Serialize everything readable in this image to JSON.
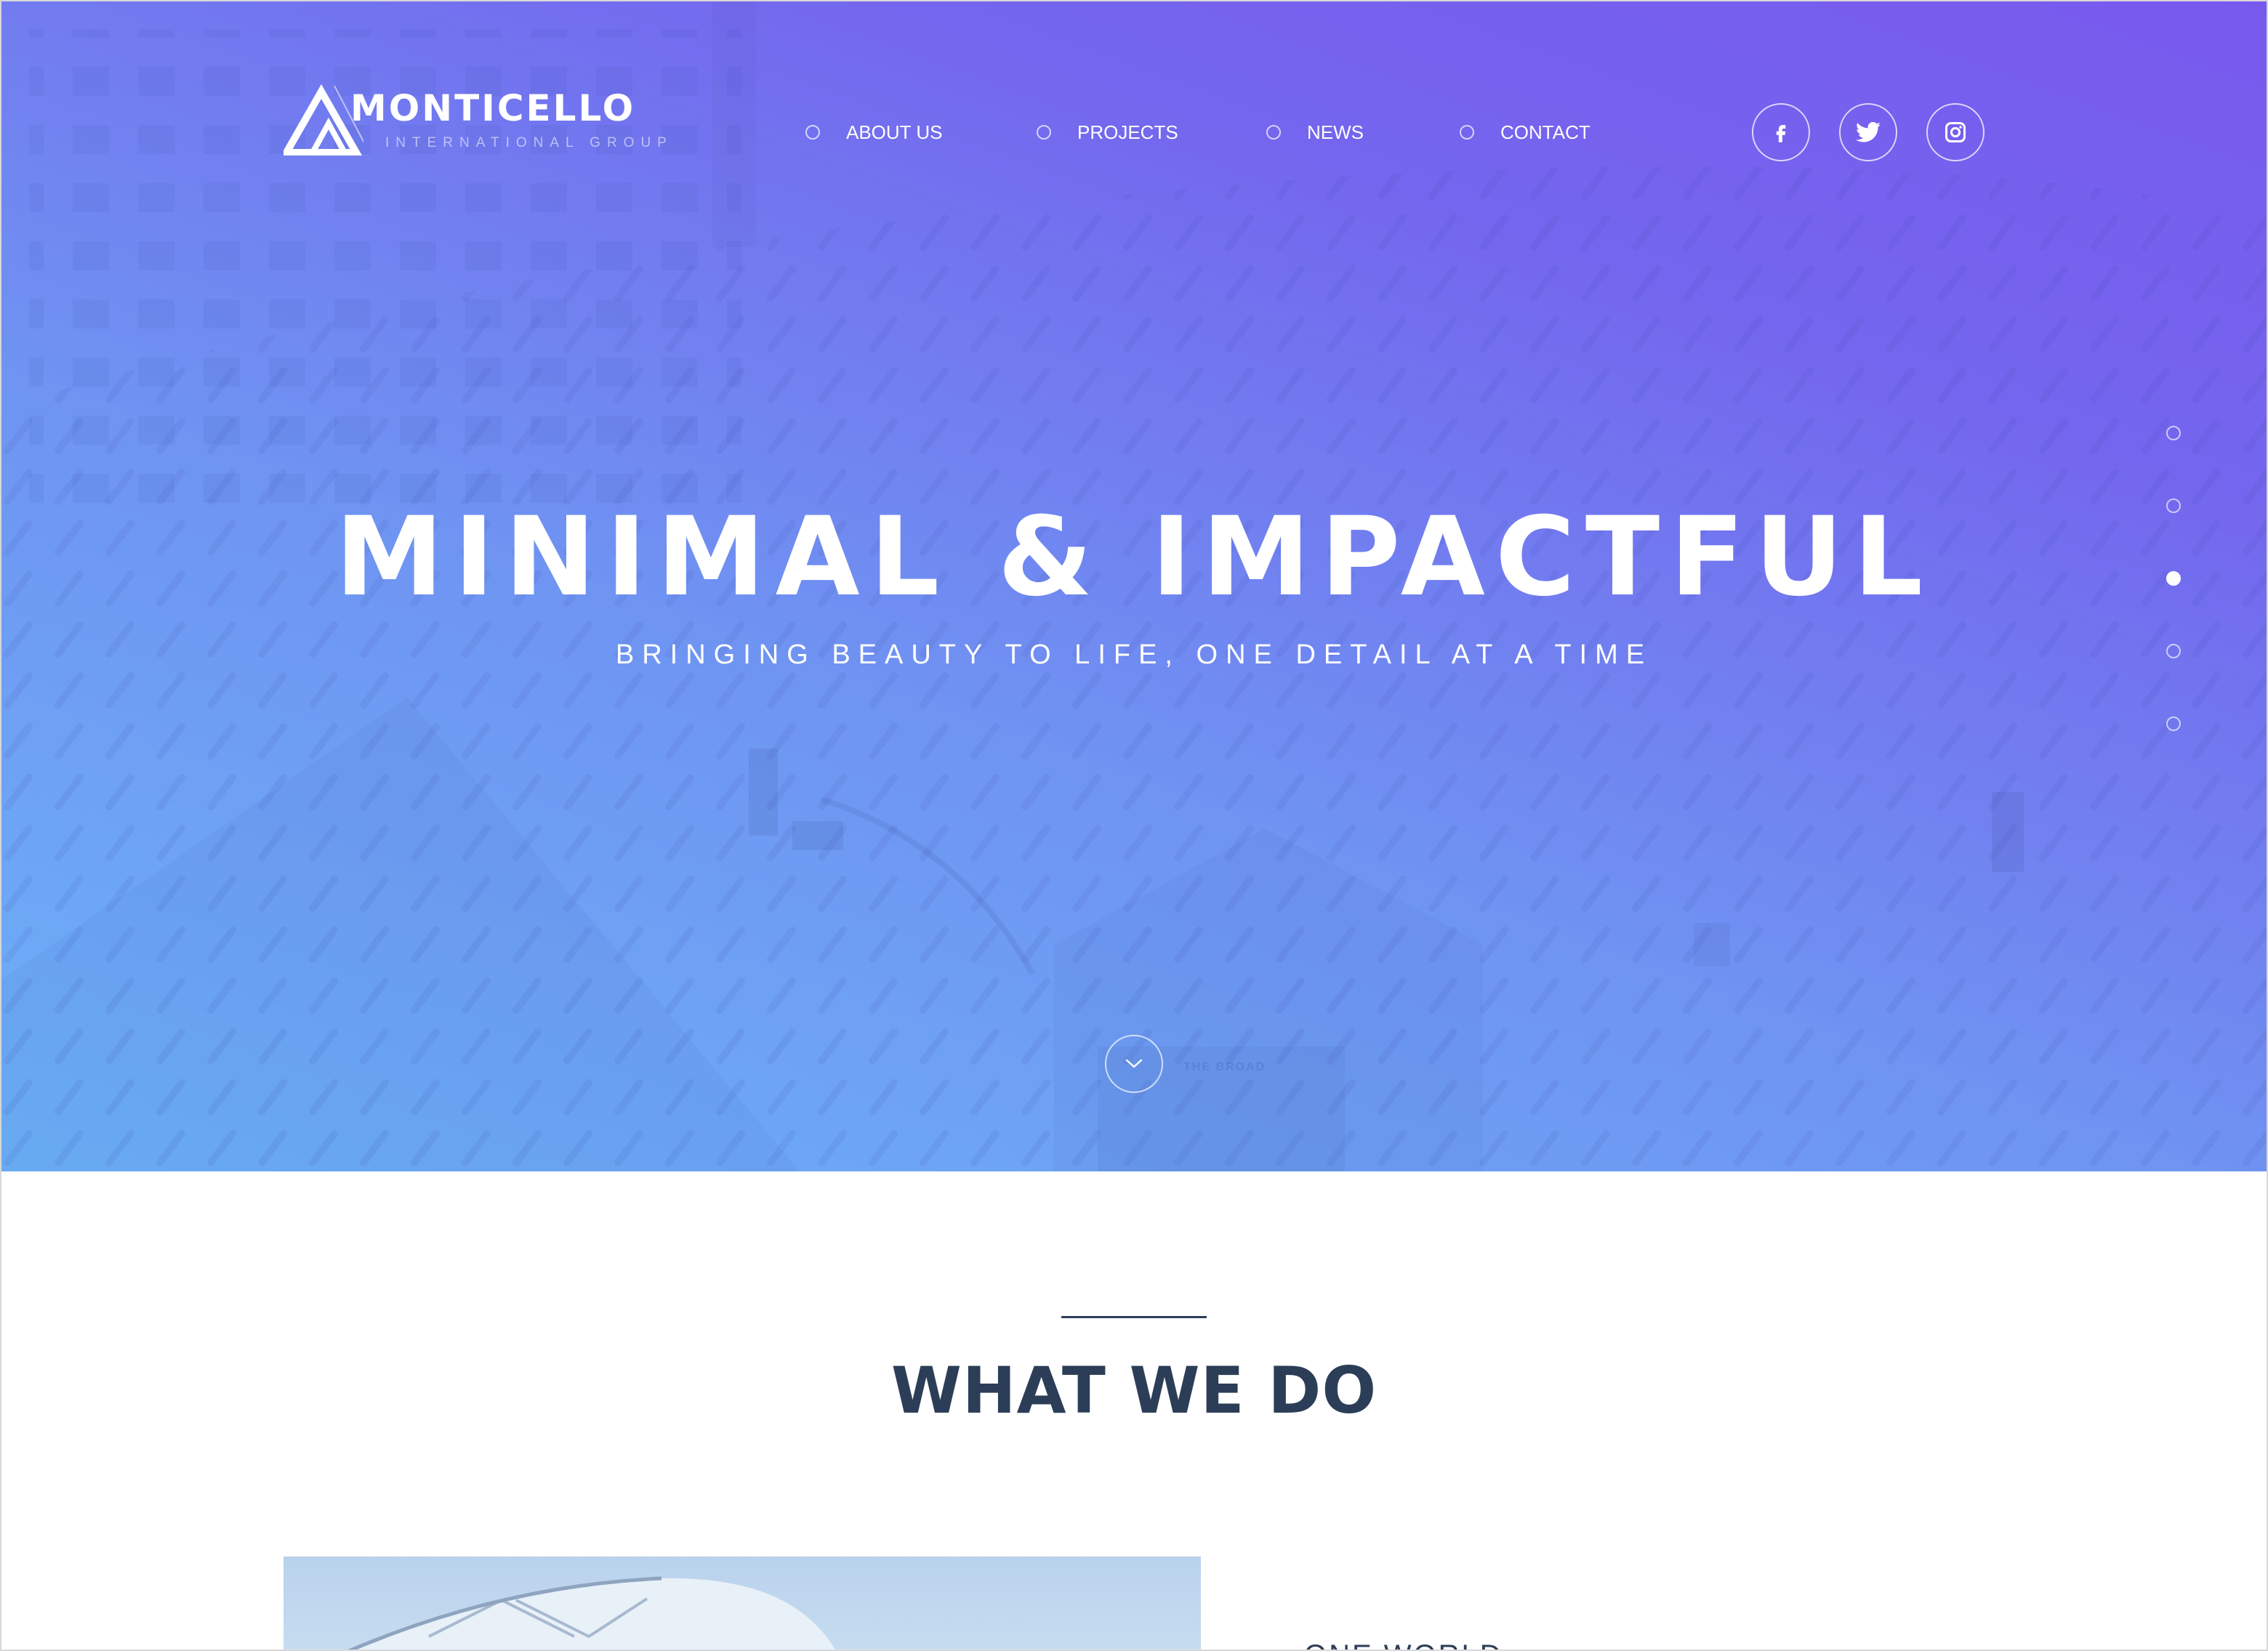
{
  "brand": {
    "name": "MONTICELLO",
    "tagline": "INTERNATIONAL GROUP"
  },
  "nav": {
    "items": [
      {
        "label": "ABOUT US"
      },
      {
        "label": "PROJECTS"
      },
      {
        "label": "NEWS"
      },
      {
        "label": "CONTACT"
      }
    ]
  },
  "social": {
    "icons": [
      "facebook-icon",
      "twitter-icon",
      "instagram-icon"
    ]
  },
  "hero": {
    "title": "MINIMAL & IMPACTFUL",
    "subtitle": "BRINGING BEAUTY TO LIFE, ONE DETAIL AT A TIME",
    "background_text": "THE BROAD",
    "slides_total": 5,
    "active_slide": 3
  },
  "section": {
    "title": "WHAT WE DO",
    "feature_heading": "ONE WORLD"
  },
  "colors": {
    "gradient_start": "#6cb1f7",
    "gradient_end": "#7859ee",
    "heading": "#2c3e57",
    "text_light": "#ffffff"
  }
}
